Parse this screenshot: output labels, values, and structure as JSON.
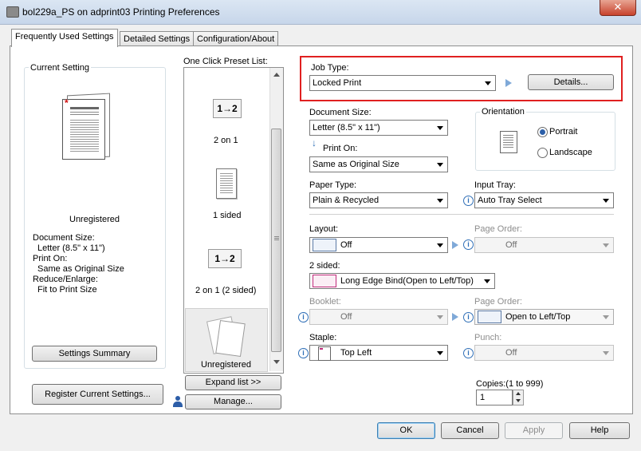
{
  "window": {
    "title": "bol229a_PS on adprint03 Printing Preferences",
    "close_glyph": "✕"
  },
  "tabs": [
    {
      "label": "Frequently Used Settings"
    },
    {
      "label": "Detailed Settings"
    },
    {
      "label": "Configuration/About"
    }
  ],
  "current_setting": {
    "heading": "Current Setting",
    "state": "Unregistered",
    "lines": [
      "Document Size:",
      "Letter (8.5\" x 11\")",
      "Print On:",
      "Same as Original Size",
      "Reduce/Enlarge:",
      "Fit to Print Size"
    ],
    "summary_button": "Settings Summary",
    "register_button": "Register Current Settings..."
  },
  "preset_list": {
    "heading": "One Click Preset List:",
    "items": [
      {
        "caption": "2 on 1",
        "icon_text": "1→2"
      },
      {
        "caption": "1 sided"
      },
      {
        "caption": "2 on 1 (2 sided)",
        "icon_text": "1→2"
      },
      {
        "caption": "Unregistered"
      }
    ],
    "expand_button": "Expand list >>",
    "manage_button": "Manage..."
  },
  "job_type": {
    "label": "Job Type:",
    "value": "Locked Print",
    "details_button": "Details..."
  },
  "document_size": {
    "label": "Document Size:",
    "value": "Letter (8.5\" x 11\")"
  },
  "print_on": {
    "label": "Print On:",
    "value": "Same as Original Size"
  },
  "orientation": {
    "label": "Orientation",
    "portrait": "Portrait",
    "landscape": "Landscape",
    "selected": "Portrait"
  },
  "paper_type": {
    "label": "Paper Type:",
    "value": "Plain & Recycled"
  },
  "input_tray": {
    "label": "Input Tray:",
    "value": "Auto Tray Select"
  },
  "layout": {
    "label": "Layout:",
    "value": "Off"
  },
  "page_order_1": {
    "label": "Page Order:",
    "value": "Off"
  },
  "two_sided": {
    "label": "2 sided:",
    "value": "Long Edge Bind(Open to Left/Top)"
  },
  "booklet": {
    "label": "Booklet:",
    "value": "Off"
  },
  "page_order_2": {
    "label": "Page Order:",
    "value": "Open to Left/Top"
  },
  "staple": {
    "label": "Staple:",
    "value": "Top Left"
  },
  "punch": {
    "label": "Punch:",
    "value": "Off"
  },
  "copies": {
    "label": "Copies:(1 to 999)",
    "value": "1"
  },
  "footer": {
    "ok": "OK",
    "cancel": "Cancel",
    "apply": "Apply",
    "help": "Help"
  },
  "colors": {
    "highlight_border": "#e02020",
    "accent": "#2c5fa8"
  }
}
